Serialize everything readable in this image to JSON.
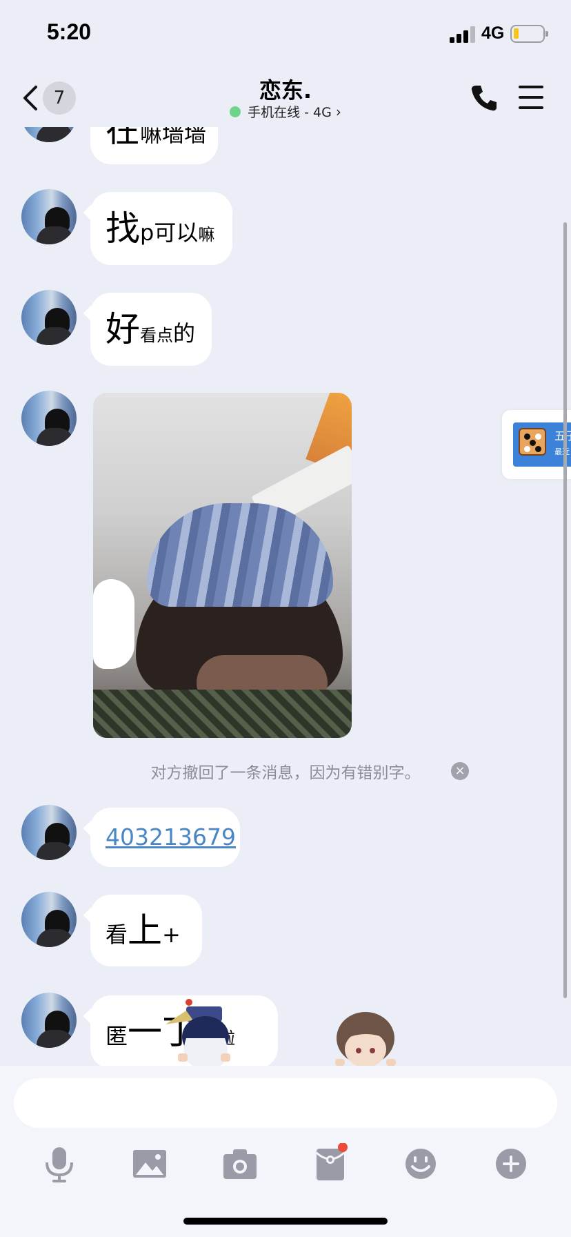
{
  "status_bar": {
    "time": "5:20",
    "network": "4G"
  },
  "nav": {
    "back_count": "7",
    "title": "恋东.",
    "status": "手机在线 - 4G",
    "status_chevron": "›"
  },
  "messages": [
    {
      "parts": [
        {
          "t": "在",
          "s": "big"
        },
        {
          "t": "嘛墙墙",
          "s": "mid"
        }
      ]
    },
    {
      "parts": [
        {
          "t": "找",
          "s": "big"
        },
        {
          "t": "p可以",
          "s": "mid"
        },
        {
          "t": "嘛",
          "s": "sml"
        }
      ]
    },
    {
      "parts": [
        {
          "t": "好",
          "s": "big"
        },
        {
          "t": "看点",
          "s": "sml"
        },
        {
          "t": "的",
          "s": "mid"
        }
      ]
    },
    {
      "link": "403213679"
    },
    {
      "parts": [
        {
          "t": "看",
          "s": "mid"
        },
        {
          "t": "上",
          "s": "big"
        },
        {
          "t": "+",
          "s": "mid"
        }
      ]
    },
    {
      "parts": [
        {
          "t": "匿",
          "s": "mid"
        },
        {
          "t": "一",
          "s": "big"
        },
        {
          "t": "丁",
          "s": "big"
        },
        {
          "t": "谢",
          "s": "mid"
        },
        {
          "t": "啦",
          "s": "sml"
        }
      ]
    }
  ],
  "recall_notice": "对方撤回了一条消息，因为有错别字。",
  "recall_close": "×",
  "game_card": {
    "title": "五子",
    "subtitle": "最近"
  },
  "input": {
    "placeholder": ""
  },
  "toolbar": [
    "microphone-icon",
    "image-icon",
    "camera-icon",
    "red-packet-icon",
    "emoji-icon",
    "plus-icon"
  ],
  "colors": {
    "link": "#4a86c5",
    "online": "#6fd38b",
    "badge_dot": "#ee4a3a",
    "toolbar_icon": "#9a9ba6"
  }
}
